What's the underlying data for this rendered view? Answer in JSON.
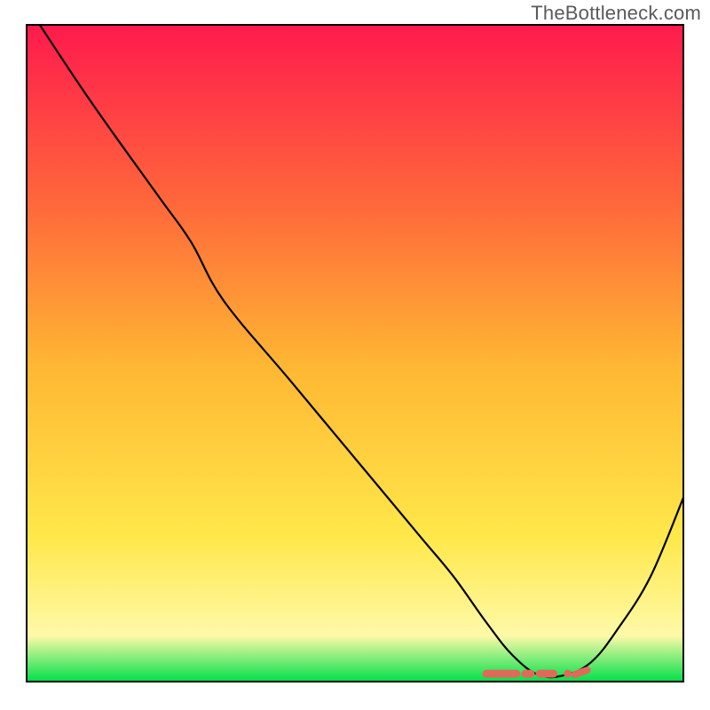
{
  "watermark": "TheBottleneck.com",
  "chart_data": {
    "type": "line",
    "title": "",
    "xlabel": "",
    "ylabel": "",
    "xlim": [
      0,
      100
    ],
    "ylim": [
      0,
      100
    ],
    "gradient": {
      "top_color": "#ff1a4d",
      "upper_mid_color": "#ff6a3a",
      "mid_color": "#ffb733",
      "lower_mid_color": "#ffe84a",
      "lower_color": "#fff9a8",
      "bottom_color": "#00e04a"
    },
    "series": [
      {
        "name": "bottleneck-curve",
        "color": "#000000",
        "x": [
          2,
          10,
          20,
          25,
          30,
          40,
          50,
          60,
          65,
          70,
          74,
          78,
          82,
          86,
          90,
          95,
          100
        ],
        "y": [
          100,
          88,
          74,
          67,
          58,
          46,
          34,
          22,
          16,
          9,
          4,
          1,
          1,
          3,
          8,
          16,
          28
        ]
      }
    ],
    "optimal_band": {
      "label": "optimal-range-marker",
      "color": "#e06a5a",
      "x_start": 70,
      "x_end": 84,
      "y": 1.2
    }
  }
}
